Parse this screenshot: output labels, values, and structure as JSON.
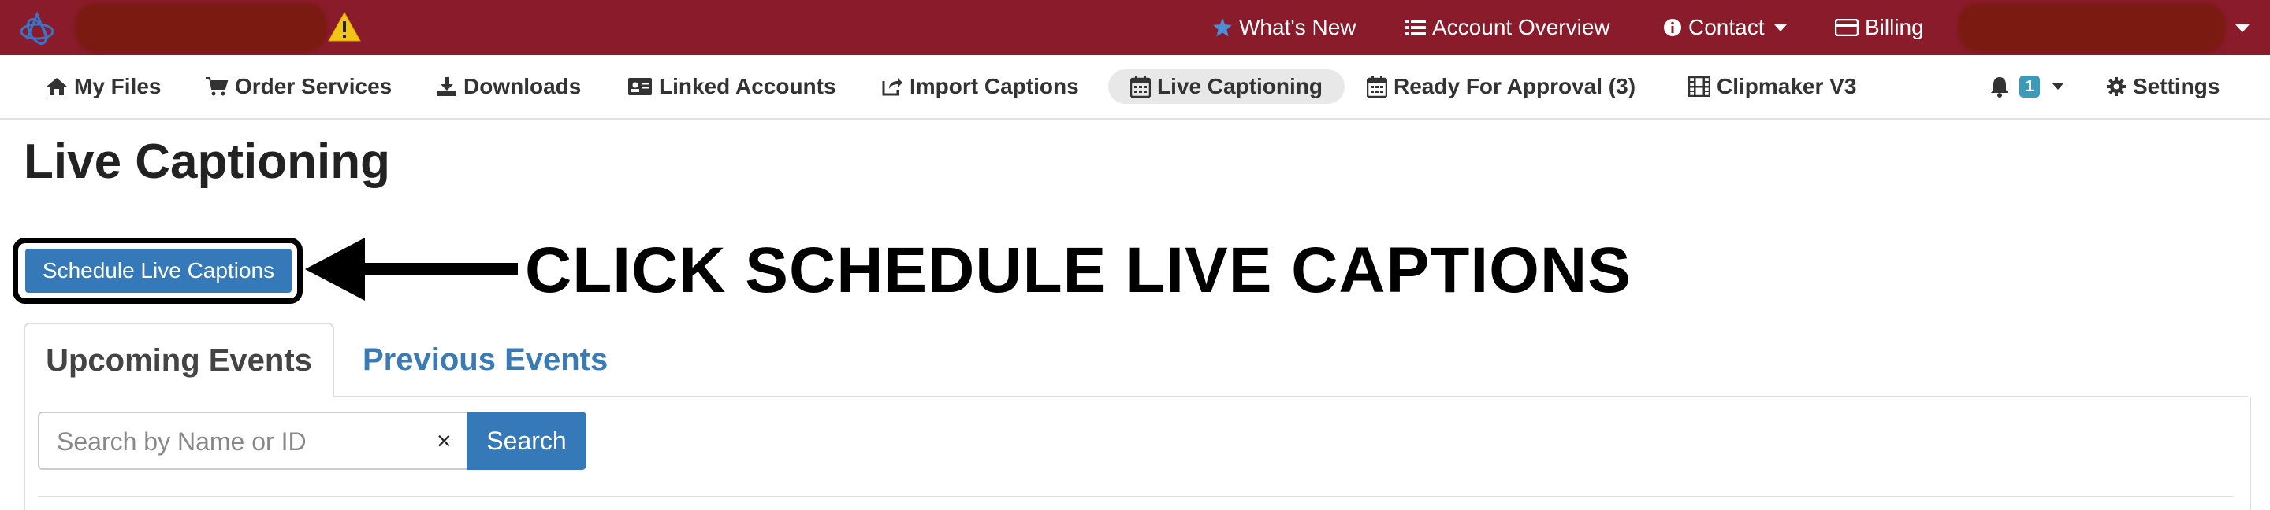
{
  "topbar": {
    "whats_new": "What's New",
    "account_overview": "Account Overview",
    "contact": "Contact",
    "billing": "Billing",
    "background": "#8a1b2b"
  },
  "nav": {
    "my_files": "My Files",
    "order_services": "Order Services",
    "downloads": "Downloads",
    "linked_accounts": "Linked Accounts",
    "import_captions": "Import Captions",
    "live_captioning": "Live Captioning",
    "ready_for_approval": "Ready For Approval (3)",
    "clipmaker": "Clipmaker V3",
    "notification_count": "1",
    "settings": "Settings"
  },
  "page": {
    "title": "Live Captioning",
    "schedule_button": "Schedule Live Captions",
    "annotation": "CLICK SCHEDULE LIVE CAPTIONS"
  },
  "tabs": [
    {
      "label": "Upcoming Events",
      "active": true
    },
    {
      "label": "Previous Events",
      "active": false
    }
  ],
  "search": {
    "placeholder": "Search by Name or ID",
    "value": "",
    "clear": "×",
    "button": "Search"
  },
  "colors": {
    "accent": "#3679b8",
    "link": "#3a7ab5",
    "badge": "#3b9ab8"
  },
  "icons": [
    "logo-icon",
    "warning-icon",
    "star-icon",
    "list-icon",
    "info-icon",
    "credit-card-icon",
    "home-icon",
    "cart-icon",
    "download-icon",
    "id-card-icon",
    "share-icon",
    "calendar-icon",
    "film-icon",
    "bell-icon",
    "gear-icon"
  ]
}
